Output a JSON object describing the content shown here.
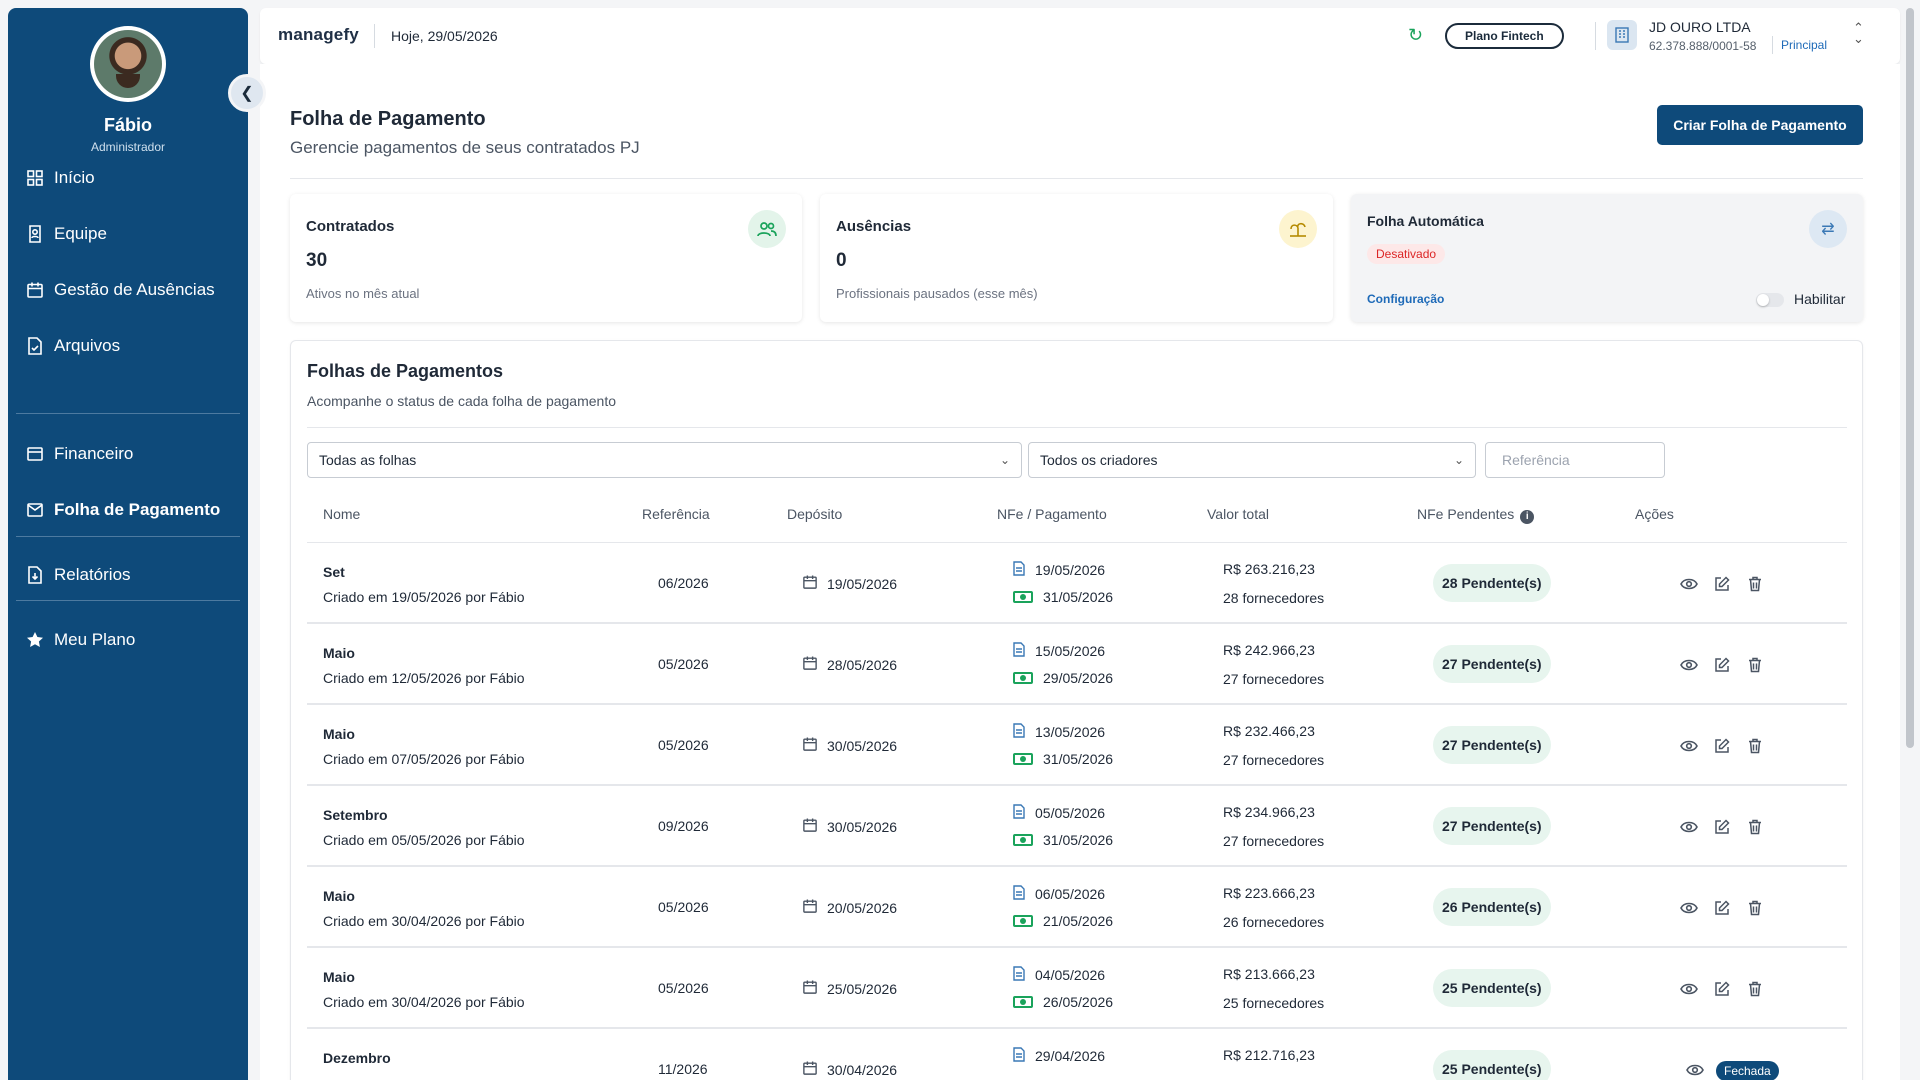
{
  "user": {
    "name": "Fábio",
    "role": "Administrador"
  },
  "sidebar": {
    "items": [
      {
        "label": "Início",
        "icon": "grid-icon"
      },
      {
        "label": "Equipe",
        "icon": "team-icon"
      },
      {
        "label": "Gestão de Ausências",
        "icon": "calendar-icon"
      },
      {
        "label": "Arquivos",
        "icon": "file-icon"
      },
      {
        "label": "Financeiro",
        "icon": "wallet-icon"
      },
      {
        "label": "Folha de Pagamento",
        "icon": "mail-icon",
        "active": true
      },
      {
        "label": "Relatórios",
        "icon": "download-icon"
      },
      {
        "label": "Meu Plano",
        "icon": "star-icon"
      }
    ]
  },
  "topbar": {
    "logo": "managefy",
    "today": "Hoje, 29/05/2026",
    "plan": "Plano Fintech",
    "company": {
      "name": "JD OURO LTDA",
      "cnpj": "62.378.888/0001-58",
      "tag": "Principal"
    }
  },
  "page": {
    "title": "Folha de Pagamento",
    "subtitle": "Gerencie pagamentos de seus contratados PJ",
    "create_button": "Criar Folha de Pagamento"
  },
  "cards": {
    "contratados": {
      "title": "Contratados",
      "value": "30",
      "desc": "Ativos no mês atual"
    },
    "ausencias": {
      "title": "Ausências",
      "value": "0",
      "desc": "Profissionais pausados (esse mês)"
    },
    "automatica": {
      "title": "Folha Automática",
      "status": "Desativado",
      "config": "Configuração",
      "toggle_label": "Habilitar"
    }
  },
  "panel": {
    "title": "Folhas de Pagamentos",
    "subtitle": "Acompanhe o status de cada folha de pagamento",
    "filter_sheets": "Todas as folhas",
    "filter_creators": "Todos os criadores",
    "ref_placeholder": "Referência"
  },
  "table": {
    "headers": {
      "nome": "Nome",
      "referencia": "Referência",
      "deposito": "Depósito",
      "nfe": "NFe / Pagamento",
      "valor": "Valor total",
      "pendentes": "NFe Pendentes",
      "acoes": "Ações"
    },
    "rows": [
      {
        "name": "Set",
        "created": "Criado em 19/05/2026 por Fábio",
        "ref": "06/2026",
        "deposit": "19/05/2026",
        "nfe": "19/05/2026",
        "pay": "31/05/2026",
        "value": "R$ 263.216,23",
        "suppliers": "28 fornecedores",
        "pending": "28 Pendente(s)"
      },
      {
        "name": "Maio",
        "created": "Criado em 12/05/2026 por Fábio",
        "ref": "05/2026",
        "deposit": "28/05/2026",
        "nfe": "15/05/2026",
        "pay": "29/05/2026",
        "value": "R$ 242.966,23",
        "suppliers": "27 fornecedores",
        "pending": "27 Pendente(s)"
      },
      {
        "name": "Maio",
        "created": "Criado em 07/05/2026 por Fábio",
        "ref": "05/2026",
        "deposit": "30/05/2026",
        "nfe": "13/05/2026",
        "pay": "31/05/2026",
        "value": "R$ 232.466,23",
        "suppliers": "27 fornecedores",
        "pending": "27 Pendente(s)"
      },
      {
        "name": "Setembro",
        "created": "Criado em 05/05/2026 por Fábio",
        "ref": "09/2026",
        "deposit": "30/05/2026",
        "nfe": "05/05/2026",
        "pay": "31/05/2026",
        "value": "R$ 234.966,23",
        "suppliers": "27 fornecedores",
        "pending": "27 Pendente(s)"
      },
      {
        "name": "Maio",
        "created": "Criado em 30/04/2026 por Fábio",
        "ref": "05/2026",
        "deposit": "20/05/2026",
        "nfe": "06/05/2026",
        "pay": "21/05/2026",
        "value": "R$ 223.666,23",
        "suppliers": "26 fornecedores",
        "pending": "26 Pendente(s)"
      },
      {
        "name": "Maio",
        "created": "Criado em 30/04/2026 por Fábio",
        "ref": "05/2026",
        "deposit": "25/05/2026",
        "nfe": "04/05/2026",
        "pay": "26/05/2026",
        "value": "R$ 213.666,23",
        "suppliers": "25 fornecedores",
        "pending": "25 Pendente(s)"
      },
      {
        "name": "Dezembro",
        "created": "",
        "ref": "11/2026",
        "deposit": "30/04/2026",
        "nfe": "29/04/2026",
        "pay": "",
        "value": "R$ 212.716,23",
        "suppliers": "",
        "pending": "25 Pendente(s)",
        "status": "Fechada"
      }
    ]
  },
  "colors": {
    "primary": "#0e4a7a",
    "success": "#1aa35b",
    "danger": "#dc2626",
    "link": "#1e6ab8"
  }
}
